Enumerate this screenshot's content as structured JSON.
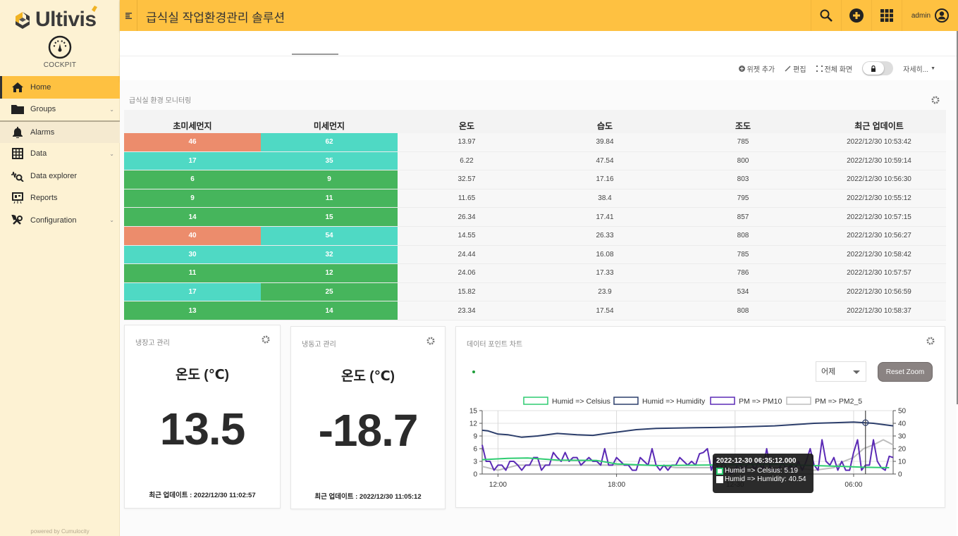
{
  "sidebar": {
    "brand": "Ultivis",
    "cockpit_label": "COCKPIT",
    "items": [
      {
        "label": "Home",
        "icon": "home-icon",
        "active": true,
        "expandable": false
      },
      {
        "label": "Groups",
        "icon": "folder-icon",
        "active": false,
        "expandable": true
      },
      {
        "label": "Alarms",
        "icon": "bell-icon",
        "active": false,
        "expandable": false
      },
      {
        "label": "Data",
        "icon": "grid-icon",
        "active": false,
        "expandable": true
      },
      {
        "label": "Data explorer",
        "icon": "data-explorer-icon",
        "active": false,
        "expandable": false
      },
      {
        "label": "Reports",
        "icon": "report-icon",
        "active": false,
        "expandable": false
      },
      {
        "label": "Configuration",
        "icon": "configuration-icon",
        "active": false,
        "expandable": true
      }
    ],
    "footer": "powered by Cumulocity"
  },
  "header": {
    "title": "급식실 작업환경관리 솔루션",
    "user": "admin"
  },
  "actions": {
    "add_widget": "위젯 추가",
    "edit": "편집",
    "fullscreen": "전체 화면",
    "more": "자세히..."
  },
  "table_widget": {
    "title": "급식실 환경 모니터링",
    "columns": [
      "초미세먼지",
      "미세먼지",
      "온도",
      "습도",
      "조도",
      "최근 업데이트"
    ],
    "colors": {
      "red": "#ec8c6c",
      "teal": "#4fd9c4",
      "green": "#46b55c"
    },
    "rows": [
      {
        "pm25": "46",
        "pm25_color": "red",
        "pm10": "62",
        "pm10_color": "teal",
        "temp": "13.97",
        "humid": "39.84",
        "lux": "785",
        "updated": "2022/12/30 10:53:42"
      },
      {
        "pm25": "17",
        "pm25_color": "teal",
        "pm10": "35",
        "pm10_color": "teal",
        "temp": "6.22",
        "humid": "47.54",
        "lux": "800",
        "updated": "2022/12/30 10:59:14"
      },
      {
        "pm25": "6",
        "pm25_color": "green",
        "pm10": "9",
        "pm10_color": "green",
        "temp": "32.57",
        "humid": "17.16",
        "lux": "803",
        "updated": "2022/12/30 10:56:30"
      },
      {
        "pm25": "9",
        "pm25_color": "green",
        "pm10": "11",
        "pm10_color": "green",
        "temp": "11.65",
        "humid": "38.4",
        "lux": "795",
        "updated": "2022/12/30 10:55:12"
      },
      {
        "pm25": "14",
        "pm25_color": "green",
        "pm10": "15",
        "pm10_color": "green",
        "temp": "26.34",
        "humid": "17.41",
        "lux": "857",
        "updated": "2022/12/30 10:57:15"
      },
      {
        "pm25": "40",
        "pm25_color": "red",
        "pm10": "54",
        "pm10_color": "teal",
        "temp": "14.55",
        "humid": "26.33",
        "lux": "808",
        "updated": "2022/12/30 10:56:27"
      },
      {
        "pm25": "30",
        "pm25_color": "teal",
        "pm10": "32",
        "pm10_color": "teal",
        "temp": "24.44",
        "humid": "16.08",
        "lux": "785",
        "updated": "2022/12/30 10:58:42"
      },
      {
        "pm25": "11",
        "pm25_color": "green",
        "pm10": "12",
        "pm10_color": "green",
        "temp": "24.06",
        "humid": "17.33",
        "lux": "786",
        "updated": "2022/12/30 10:57:57"
      },
      {
        "pm25": "17",
        "pm25_color": "teal",
        "pm10": "25",
        "pm10_color": "green",
        "temp": "15.82",
        "humid": "23.9",
        "lux": "534",
        "updated": "2022/12/30 10:56:59"
      },
      {
        "pm25": "13",
        "pm25_color": "green",
        "pm10": "14",
        "pm10_color": "green",
        "temp": "23.34",
        "humid": "17.54",
        "lux": "808",
        "updated": "2022/12/30 10:58:37"
      }
    ]
  },
  "fridge_widget": {
    "title": "냉장고 관리",
    "label": "온도 (℃)",
    "value": "13.5",
    "updated": "최근 업데이트 : 2022/12/30 11:02:57"
  },
  "freezer_widget": {
    "title": "냉동고 관리",
    "label": "온도 (℃)",
    "value": "-18.7",
    "updated": "최근 업데이트 : 2022/12/30 11:05:12"
  },
  "chart_widget": {
    "title": "데이터 포인트 차트",
    "range_select": "어제",
    "reset_zoom": "Reset Zoom",
    "tooltip": {
      "title": "2022-12-30 06:35:12.000",
      "rows": [
        {
          "label": "Humid => Celsius: 5.19",
          "color": "#2ecc71"
        },
        {
          "label": "Humid => Humidity: 40.54",
          "color": "#2c3e6b"
        }
      ]
    }
  },
  "chart_data": {
    "type": "line",
    "title": "데이터 포인트 차트",
    "x_ticks": [
      "12:00",
      "18:00",
      "12-30",
      "06:00"
    ],
    "x_range_hours": [
      11.2,
      32.0
    ],
    "y_left": {
      "ticks": [
        0,
        3,
        6,
        9,
        12,
        15
      ],
      "range": [
        0,
        15
      ]
    },
    "y_right": {
      "ticks": [
        0,
        10,
        20,
        30,
        40,
        50
      ],
      "range": [
        0,
        50
      ]
    },
    "legend": "top-center",
    "grid": true,
    "series": [
      {
        "name": "Humid => Celsius",
        "color": "#2ecc71",
        "axis": "left",
        "x": [
          11.2,
          12.5,
          13.5,
          15,
          17,
          18,
          20,
          22,
          24,
          26,
          28,
          29.5,
          30.5,
          31.8
        ],
        "values": [
          3.4,
          3.7,
          3.8,
          3.3,
          3.2,
          2.4,
          2.0,
          2.1,
          2.2,
          2.3,
          2.0,
          1.8,
          1.6,
          1.5,
          3.6
        ]
      },
      {
        "name": "Humid => Humidity",
        "color": "#2c3e6b",
        "axis": "right",
        "x": [
          11.2,
          11.5,
          12.0,
          12.5,
          13.2,
          14.0,
          15.0,
          16.0,
          16.8,
          17.5,
          18.0,
          19.0,
          20.0,
          22.0,
          24.0,
          26.0,
          28.0,
          29.1,
          30.0,
          31.0,
          32.0
        ],
        "values": [
          34.5,
          34,
          31.5,
          31,
          29,
          30,
          32,
          31,
          30.5,
          32,
          33,
          35,
          36,
          36.5,
          37,
          38,
          40,
          40.5,
          41,
          40,
          38
        ]
      },
      {
        "name": "PM => PM10",
        "color": "#5b2ab5",
        "axis": "right",
        "x": [
          11.2,
          11.4,
          11.6,
          11.8,
          12.0,
          12.2,
          12.4,
          12.6,
          12.8,
          13.0,
          13.2,
          13.4,
          13.6,
          13.8,
          14.0,
          14.2,
          14.4,
          14.6,
          14.8,
          15.0,
          15.2,
          15.4,
          15.6,
          15.8,
          16.0,
          16.2,
          16.4,
          16.6,
          16.8,
          17.0,
          17.2,
          17.4,
          17.6,
          17.8,
          18.0,
          18.2,
          18.4,
          18.6,
          18.8,
          19.0,
          19.2,
          19.4,
          19.6,
          19.8,
          20.0,
          20.2,
          20.4,
          20.6,
          20.8,
          21.0,
          21.2,
          21.4,
          21.6,
          21.8,
          22.0,
          22.2,
          22.4,
          22.6,
          22.8,
          23.0,
          23.2,
          23.4,
          23.6,
          23.8,
          24.0,
          24.2,
          24.4,
          24.6,
          24.8,
          25.0,
          25.2,
          25.4,
          25.6,
          25.8,
          26.0,
          26.2,
          26.4,
          26.6,
          26.8,
          27.0,
          27.2,
          27.4,
          27.6,
          27.8,
          28.0,
          28.2,
          28.4,
          28.6,
          28.8,
          29.0,
          29.2,
          29.4,
          29.6,
          29.8,
          30.0,
          30.2,
          30.4,
          30.6,
          30.8,
          31.0,
          31.2,
          31.4,
          31.6,
          31.8,
          32.0
        ],
        "values": [
          23,
          10,
          10,
          3,
          7,
          7,
          3,
          10,
          10,
          7,
          3,
          7,
          7,
          13,
          13,
          3,
          7,
          7,
          17,
          13,
          10,
          17,
          10,
          13,
          13,
          7,
          10,
          13,
          10,
          10,
          7,
          20,
          7,
          7,
          13,
          10,
          7,
          7,
          3,
          3,
          13,
          10,
          7,
          20,
          7,
          3,
          7,
          3,
          7,
          7,
          13,
          10,
          7,
          10,
          7,
          16,
          17,
          20,
          3,
          13,
          0,
          10,
          3,
          0,
          3,
          10,
          3,
          7,
          10,
          3,
          10,
          3,
          20,
          3,
          3,
          3,
          10,
          3,
          7,
          3,
          10,
          3,
          10,
          20,
          7,
          3,
          27,
          10,
          7,
          13,
          3,
          10,
          3,
          3,
          17,
          27,
          3,
          7,
          7,
          27,
          10,
          5,
          3,
          14,
          13,
          20,
          17,
          43,
          10,
          30,
          23,
          20,
          47,
          34,
          30,
          37,
          27,
          23,
          37,
          30
        ]
      },
      {
        "name": "PM => PM2_5",
        "color": "#bdbdbd",
        "axis": "right",
        "x": [
          11.2,
          12,
          13,
          14,
          15,
          16,
          17,
          18,
          19,
          20,
          21,
          22,
          23,
          24,
          25,
          26,
          27,
          28,
          29,
          29.5,
          30,
          30.5,
          31,
          31.5,
          32
        ],
        "values": [
          6,
          3,
          7,
          7,
          7,
          7,
          7,
          7,
          7,
          7,
          5,
          5,
          5,
          5,
          5,
          5,
          5,
          3,
          5,
          10,
          13,
          20,
          23,
          27,
          23
        ]
      }
    ]
  }
}
